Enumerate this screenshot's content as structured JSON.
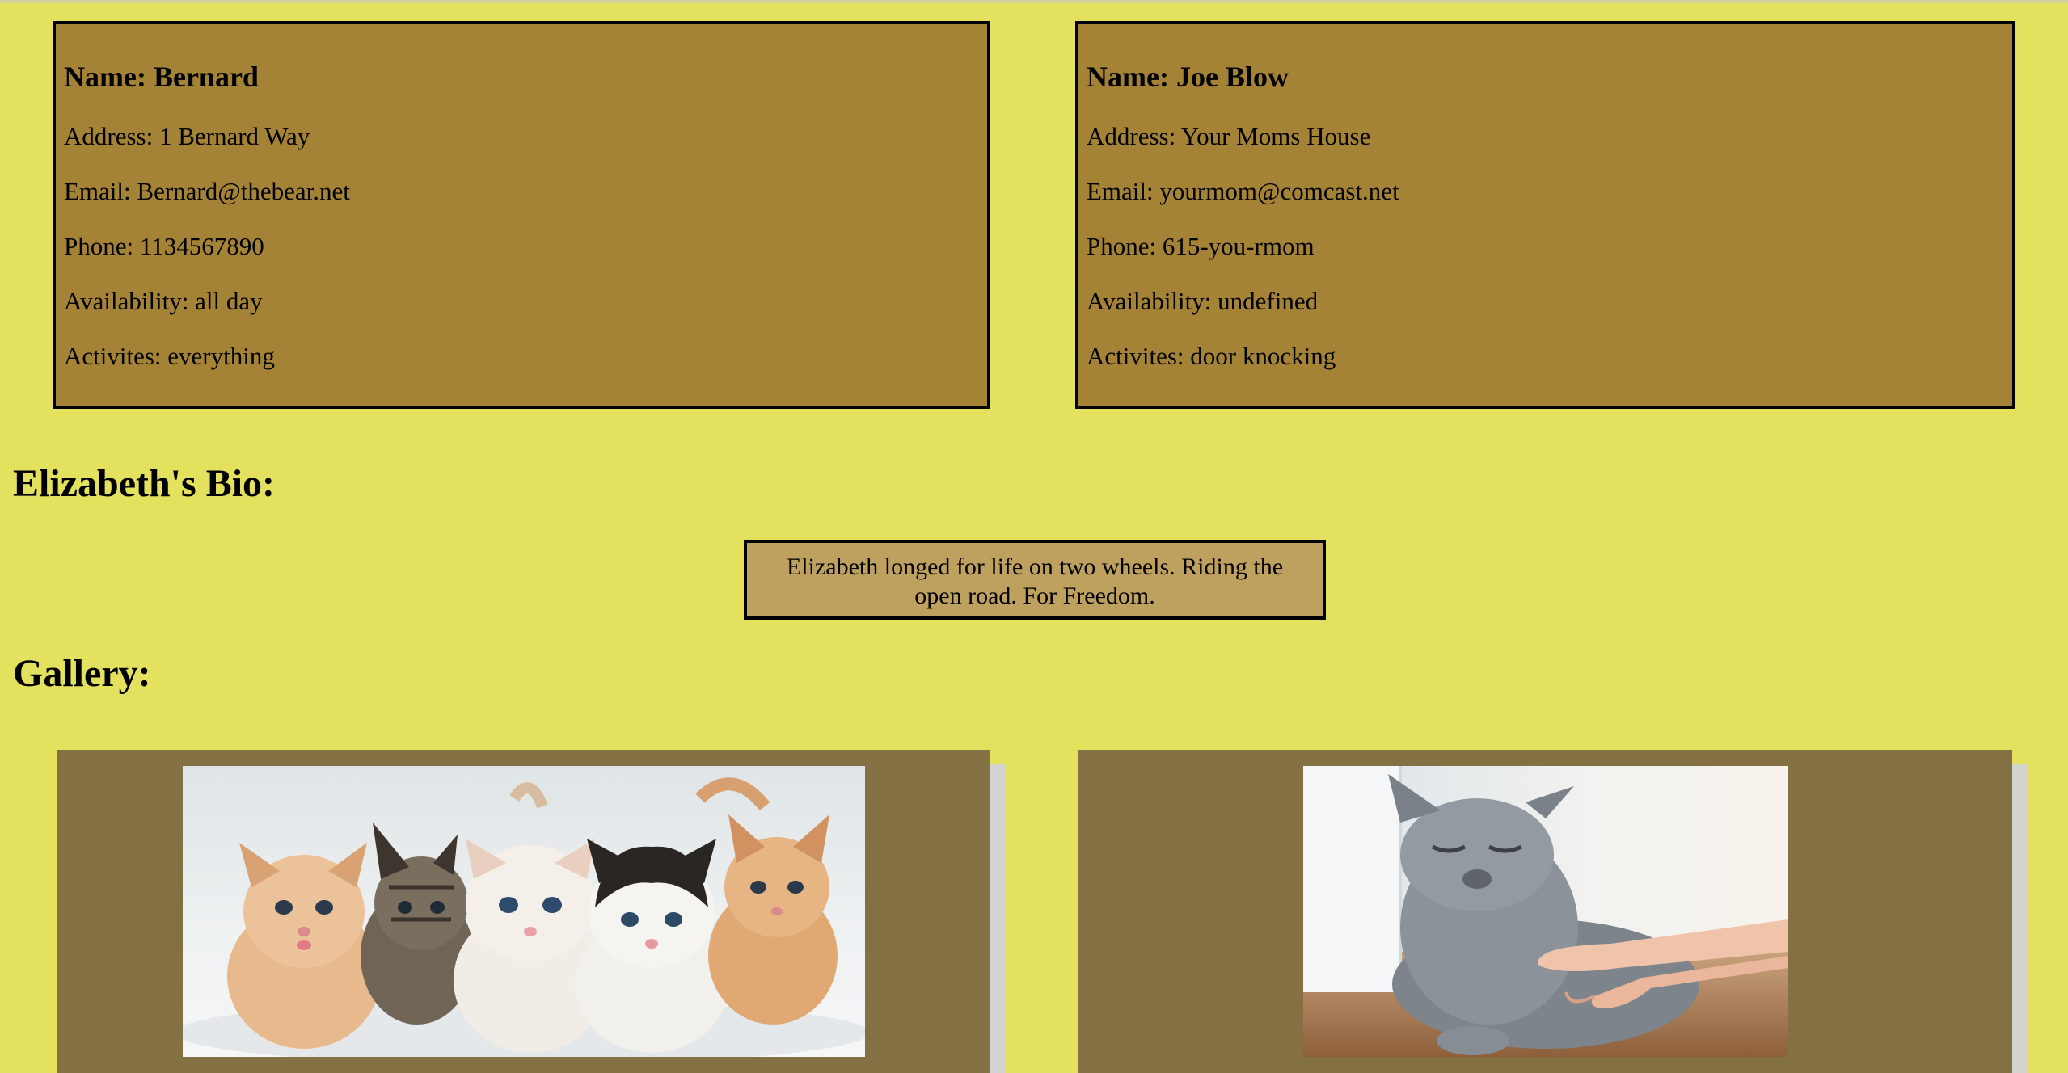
{
  "cards": [
    {
      "name": "Name: Bernard",
      "address": "Address: 1 Bernard Way",
      "email": "Email: Bernard@thebear.net",
      "phone": "Phone: 1134567890",
      "availability": "Availability: all day",
      "activities": "Activites: everything"
    },
    {
      "name": "Name: Joe Blow",
      "address": "Address: Your Moms House",
      "email": "Email: yourmom@comcast.net",
      "phone": "Phone: 615-you-rmom",
      "availability": "Availability: undefined",
      "activities": "Activites: door knocking"
    }
  ],
  "bio": {
    "heading": "Elizabeth's Bio:",
    "text": "Elizabeth longed for life on two wheels. Riding the open road. For Freedom."
  },
  "gallery": {
    "heading": "Gallery:",
    "images": [
      {
        "subject": "five kittens"
      },
      {
        "subject": "grey cat being petted"
      }
    ]
  },
  "colors": {
    "page_background": "#e4e15e",
    "card_background": "#a48336",
    "bio_background": "#bea05f",
    "gallery_background": "#837043"
  }
}
